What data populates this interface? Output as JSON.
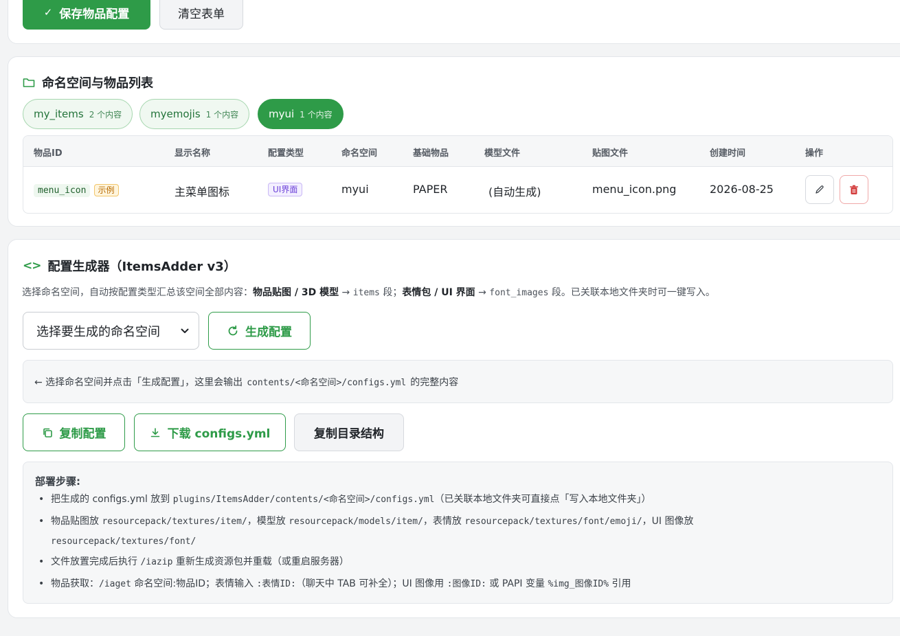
{
  "top_actions": {
    "save_label": "保存物品配置",
    "clear_label": "清空表单"
  },
  "namespace_section": {
    "title": "命名空间与物品列表",
    "namespaces": [
      {
        "name": "my_items",
        "count": "2 个内容",
        "active": false
      },
      {
        "name": "myemojis",
        "count": "1 个内容",
        "active": false
      },
      {
        "name": "myui",
        "count": "1 个内容",
        "active": true
      }
    ],
    "table": {
      "headers": [
        "物品ID",
        "显示名称",
        "配置类型",
        "命名空间",
        "基础物品",
        "模型文件",
        "贴图文件",
        "创建时间",
        "操作"
      ],
      "rows": [
        {
          "id": "menu_icon",
          "example_badge": "示例",
          "display_name": "主菜单图标",
          "config_type": "UI界面",
          "namespace": "myui",
          "base_item": "PAPER",
          "model_file": "(自动生成)",
          "texture_file": "menu_icon.png",
          "created": "2026-08-25"
        }
      ]
    }
  },
  "generator_section": {
    "title": "配置生成器（ItemsAdder v3）",
    "desc": {
      "p1": "选择命名空间，自动按配置类型汇总该空间全部内容：",
      "b1": "物品贴图 / 3D 模型",
      "arrow1": " → ",
      "code1": "items",
      "p2": " 段；",
      "b2": "表情包 / UI 界面",
      "arrow2": " → ",
      "code2": "font_images",
      "p3": " 段。已关联本地文件夹时可一键写入。"
    },
    "select_placeholder": "选择要生成的命名空间",
    "generate_label": "生成配置",
    "output": {
      "p1": "← 选择命名空间并点击「生成配置」，这里会输出",
      "code": "contents/<命名空间>/configs.yml",
      "p2": "的完整内容"
    },
    "copy_label": "复制配置",
    "download_label": "下载 configs.yml",
    "copy_dir_label": "复制目录结构",
    "steps": {
      "title": "部署步骤:",
      "items": [
        {
          "t1": "把生成的 configs.yml 放到 ",
          "c1": "plugins/ItemsAdder/contents/<命名空间>/configs.yml",
          "t2": "（已关联本地文件夹可直接点「写入本地文件夹」）"
        },
        {
          "t1": "物品贴图放 ",
          "c1": "resourcepack/textures/item/",
          "t2": "，模型放 ",
          "c2": "resourcepack/models/item/",
          "t3": "，表情放 ",
          "c3": "resourcepack/textures/font/emoji/",
          "t4": "，UI 图像放",
          "c4": "resourcepack/textures/font/"
        },
        {
          "t1": "文件放置完成后执行 ",
          "c1": "/iazip",
          "t2": " 重新生成资源包并重载（或重启服务器）"
        },
        {
          "t1": "物品获取：",
          "c1": "/iaget",
          "t2": " 命名空间:物品ID；表情输入 ",
          "c2": ":表情ID:",
          "t3": "（聊天中 TAB 可补全）；UI 图像用 ",
          "c3": ":图像ID:",
          "t4": " 或 PAPI 变量 ",
          "c4": "%img_图像ID%",
          "t5": " 引用"
        }
      ]
    }
  },
  "colors": {
    "accent": "#2e9b48",
    "danger": "#d33b3b",
    "background": "#f3f4f5"
  }
}
